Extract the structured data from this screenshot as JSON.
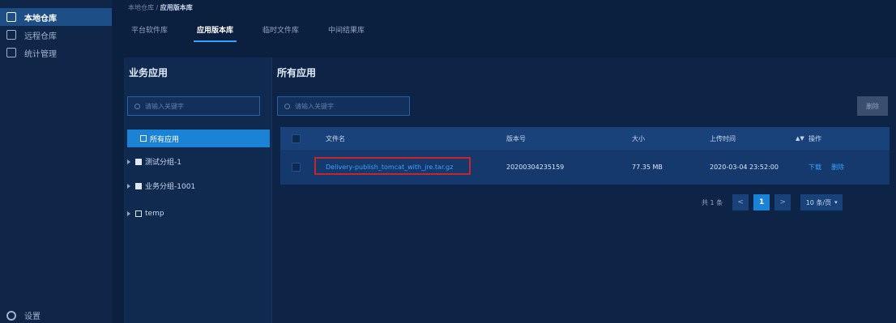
{
  "nav": {
    "items": [
      {
        "label": "本地仓库",
        "icon": "local-repo-icon"
      },
      {
        "label": "远程仓库",
        "icon": "remote-repo-icon"
      },
      {
        "label": "统计管理",
        "icon": "stats-icon"
      }
    ],
    "bottom": {
      "label": "设置",
      "icon": "gear-icon"
    }
  },
  "breadcrumb": {
    "parent": "本地仓库",
    "separator": " / ",
    "current": "应用版本库"
  },
  "tabs": [
    "平台软件库",
    "应用版本库",
    "临时文件库",
    "中间结果库"
  ],
  "left_panel": {
    "title": "业务应用",
    "search_placeholder": "请输入关键字",
    "tree": {
      "all_label": "所有应用",
      "groups": [
        "测试分组-1",
        "业务分组-1001",
        "temp"
      ]
    }
  },
  "right_panel": {
    "title": "所有应用",
    "search_placeholder": "请输入关键字",
    "delete_label": "删除",
    "columns": {
      "name": "文件名",
      "version": "版本号",
      "size": "大小",
      "uploaded": "上传时间",
      "actions": "操作"
    },
    "rows": [
      {
        "name": "Delivery-publish_tomcat_with_jre.tar.gz",
        "version": "20200304235159",
        "size": "77.35 MB",
        "uploaded": "2020-03-04 23:52:00",
        "download": "下载",
        "delete": "删除"
      }
    ],
    "pagination": {
      "total": "共 1 条",
      "prev": "<",
      "page": "1",
      "next": ">",
      "page_size": "10 条/页"
    }
  },
  "colors": {
    "accent": "#1b83d6",
    "highlight_border": "#c4262b",
    "background": "#0b1f3f"
  }
}
